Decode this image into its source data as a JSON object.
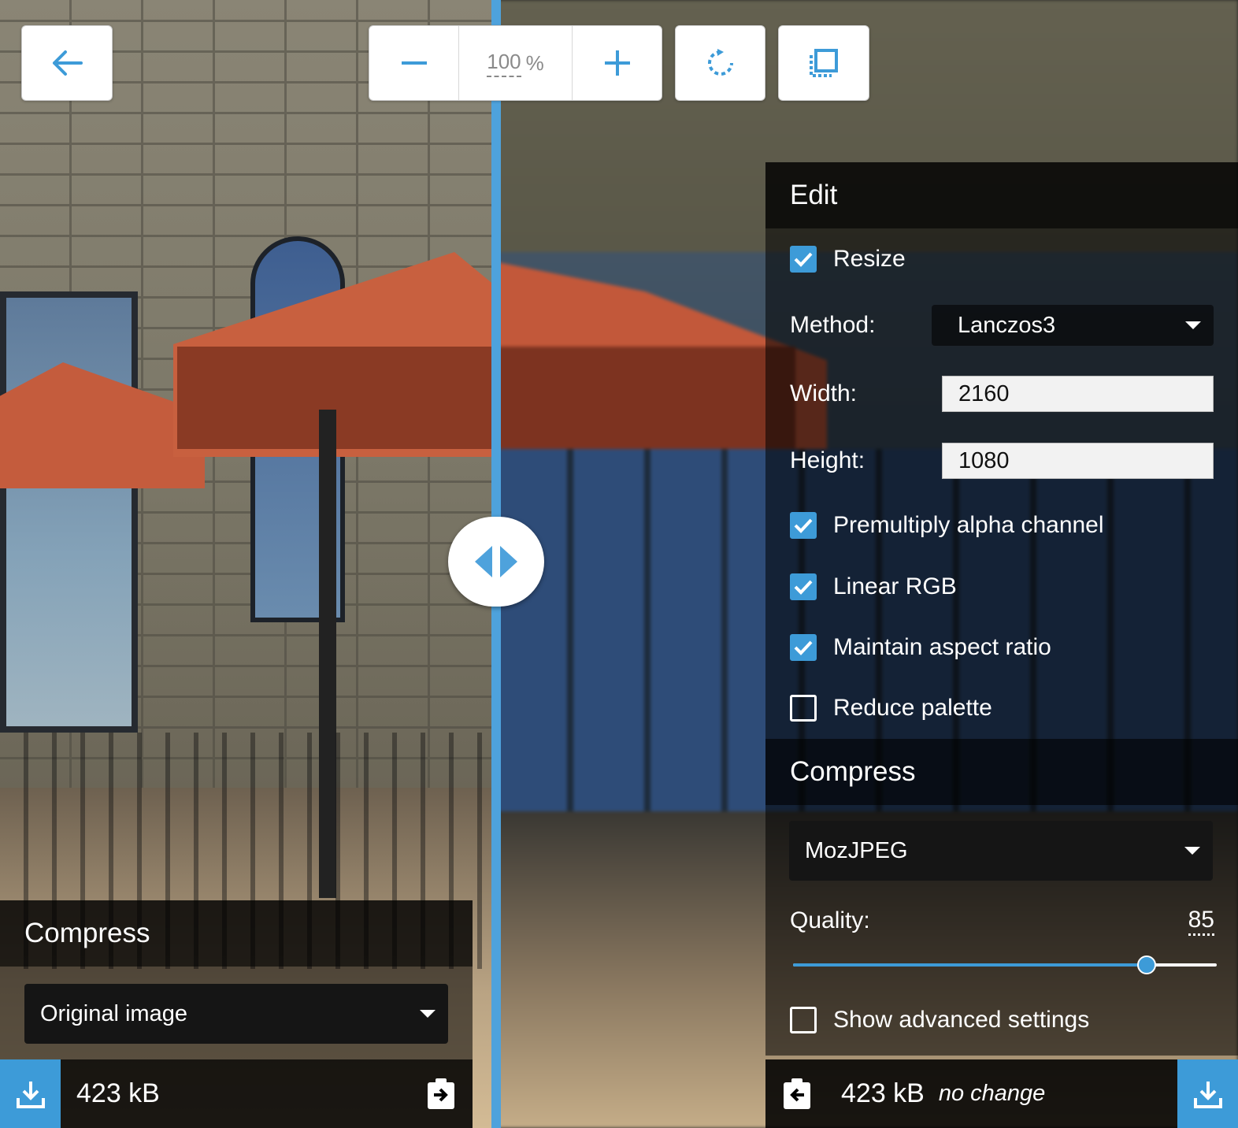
{
  "toolbar": {
    "zoom_value": "100",
    "zoom_unit": "%"
  },
  "edit_panel": {
    "title": "Edit",
    "resize_label": "Resize",
    "resize_checked": true,
    "method_label": "Method:",
    "method_value": "Lanczos3",
    "width_label": "Width:",
    "width_value": "2160",
    "height_label": "Height:",
    "height_value": "1080",
    "premultiply_label": "Premultiply alpha channel",
    "premultiply_checked": true,
    "linear_rgb_label": "Linear RGB",
    "linear_rgb_checked": true,
    "aspect_label": "Maintain aspect ratio",
    "aspect_checked": true,
    "reduce_palette_label": "Reduce palette",
    "reduce_palette_checked": false
  },
  "compress_panel_right": {
    "title": "Compress",
    "codec_value": "MozJPEG",
    "quality_label": "Quality:",
    "quality_value": "85",
    "quality_fraction": 0.835,
    "advanced_label": "Show advanced settings",
    "advanced_checked": false
  },
  "compress_panel_left": {
    "title": "Compress",
    "codec_value": "Original image"
  },
  "result_left": {
    "size": "423 kB"
  },
  "result_right": {
    "size": "423 kB",
    "note": "no change"
  },
  "colors": {
    "accent": "#3d9bd8",
    "divider": "#4ea2dc"
  }
}
